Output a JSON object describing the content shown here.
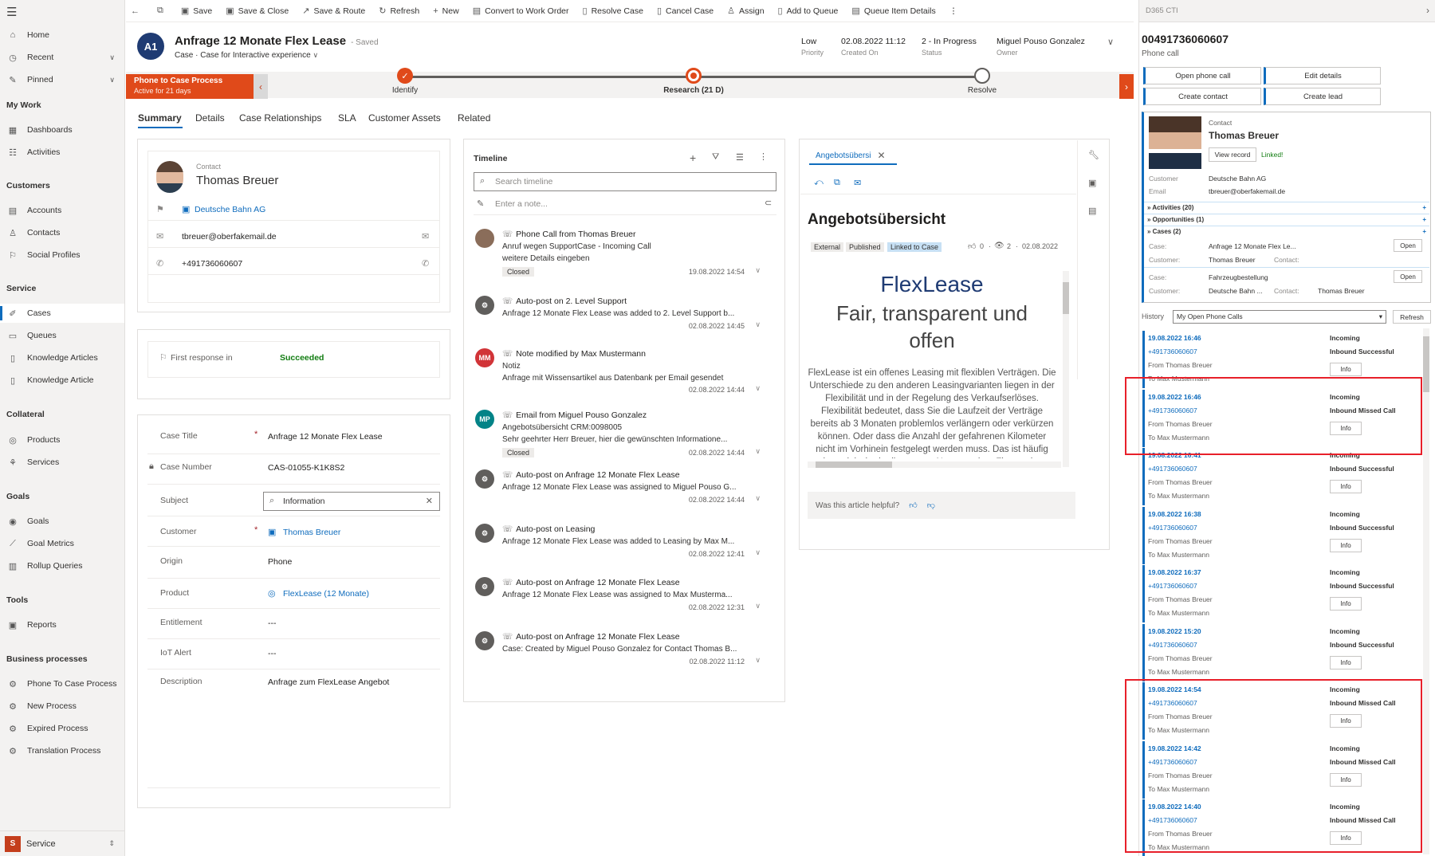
{
  "sidebar": {
    "top": [
      {
        "label": "Home",
        "icon": "home-icon"
      },
      {
        "label": "Recent",
        "icon": "clock-icon"
      },
      {
        "label": "Pinned",
        "icon": "pin-icon"
      }
    ],
    "sections": [
      {
        "title": "My Work",
        "items": [
          "Dashboards",
          "Activities"
        ]
      },
      {
        "title": "Customers",
        "items": [
          "Accounts",
          "Contacts",
          "Social Profiles"
        ]
      },
      {
        "title": "Service",
        "items": [
          "Cases",
          "Queues",
          "Knowledge Articles",
          "Knowledge Article"
        ]
      },
      {
        "title": "Collateral",
        "items": [
          "Products",
          "Services"
        ]
      },
      {
        "title": "Goals",
        "items": [
          "Goals",
          "Goal Metrics",
          "Rollup Queries"
        ]
      },
      {
        "title": "Tools",
        "items": [
          "Reports"
        ]
      },
      {
        "title": "Business processes",
        "items": [
          "Phone To Case Process",
          "New Process",
          "Expired Process",
          "Translation Process"
        ]
      }
    ],
    "area_badge": "S",
    "area_label": "Service"
  },
  "commands": [
    "Save",
    "Save & Close",
    "Save & Route",
    "Refresh",
    "New",
    "Convert to Work Order",
    "Resolve Case",
    "Cancel Case",
    "Assign",
    "Add to Queue",
    "Queue Item Details"
  ],
  "record": {
    "avatar": "A1",
    "title": "Anfrage 12 Monate Flex Lease",
    "saved": "- Saved",
    "entity": "Case",
    "form": "Case for Interactive experience",
    "priority_value": "Low",
    "priority_label": "Priority",
    "created_value": "02.08.2022 11:12",
    "created_label": "Created On",
    "status_value": "2 - In Progress",
    "status_label": "Status",
    "owner_value": "Miguel Pouso Gonzalez",
    "owner_label": "Owner"
  },
  "bpf": {
    "process": "Phone to Case Process",
    "active_for": "Active for 21 days",
    "stages": [
      "Identify",
      "Research  (21 D)",
      "Resolve"
    ]
  },
  "tabs": [
    "Summary",
    "Details",
    "Case Relationships",
    "SLA",
    "Customer Assets",
    "Related"
  ],
  "contact_card": {
    "label": "Contact",
    "name": "Thomas Breuer",
    "account": "Deutsche Bahn AG",
    "email": "tbreuer@oberfakemail.de",
    "phone": "+491736060607"
  },
  "sla": {
    "label": "First response in",
    "value": "Succeeded"
  },
  "case_fields": [
    {
      "label": "Case Title",
      "value": "Anfrage 12 Monate Flex Lease",
      "required": true
    },
    {
      "label": "Case Number",
      "value": "CAS-01055-K1K8S2",
      "locked": true
    },
    {
      "label": "Subject",
      "value": "Information"
    },
    {
      "label": "Customer",
      "value": "Thomas Breuer",
      "required": true
    },
    {
      "label": "Origin",
      "value": "Phone"
    },
    {
      "label": "Product",
      "value": "FlexLease (12 Monate)"
    },
    {
      "label": "Entitlement",
      "value": "---"
    },
    {
      "label": "IoT Alert",
      "value": "---"
    },
    {
      "label": "Description",
      "value": "Anfrage zum FlexLease Angebot"
    }
  ],
  "timeline": {
    "title": "Timeline",
    "search_placeholder": "Search timeline",
    "note_placeholder": "Enter a note...",
    "items": [
      {
        "avatar": "",
        "avatar_color": "#8a6d5a",
        "title": "Phone Call from Thomas Breuer",
        "line2": "Anruf wegen SupportCase - Incoming Call",
        "line3": "weitere Details eingeben",
        "badge": "Closed",
        "date": "19.08.2022 14:54"
      },
      {
        "avatar": "⚙",
        "avatar_color": "#605e5c",
        "title": "Auto-post on 2. Level Support",
        "line2": "Anfrage 12 Monate Flex Lease was added to 2. Level Support b...",
        "line3": "",
        "badge": "",
        "date": "02.08.2022 14:45"
      },
      {
        "avatar": "MM",
        "avatar_color": "#d13438",
        "title": "Note modified by Max Mustermann",
        "line2": "Notiz",
        "line3": "Anfrage mit Wissensartikel aus Datenbank per Email gesendet",
        "badge": "",
        "date": "02.08.2022 14:44"
      },
      {
        "avatar": "MP",
        "avatar_color": "#038387",
        "title": "Email from Miguel Pouso Gonzalez",
        "line2": "Angebotsübersicht CRM:0098005",
        "line3": "Sehr geehrter Herr Breuer,   hier die gewünschten Informatione...",
        "badge": "Closed",
        "date": "02.08.2022 14:44"
      },
      {
        "avatar": "⚙",
        "avatar_color": "#605e5c",
        "title": "Auto-post on Anfrage 12 Monate Flex Lease",
        "line2": "Anfrage 12 Monate Flex Lease was assigned to Miguel Pouso G...",
        "line3": "",
        "badge": "",
        "date": "02.08.2022 14:44"
      },
      {
        "avatar": "⚙",
        "avatar_color": "#605e5c",
        "title": "Auto-post on Leasing",
        "line2": "Anfrage 12 Monate Flex Lease was added to Leasing by Max M...",
        "line3": "",
        "badge": "",
        "date": "02.08.2022 12:41"
      },
      {
        "avatar": "⚙",
        "avatar_color": "#605e5c",
        "title": "Auto-post on Anfrage 12 Monate Flex Lease",
        "line2": "Anfrage 12 Monate Flex Lease was assigned to Max Musterma...",
        "line3": "",
        "badge": "",
        "date": "02.08.2022 12:31"
      },
      {
        "avatar": "⚙",
        "avatar_color": "#605e5c",
        "title": "Auto-post on Anfrage 12 Monate Flex Lease",
        "line2": "Case: Created by Miguel Pouso Gonzalez for Contact Thomas B...",
        "line3": "",
        "badge": "",
        "date": "02.08.2022 11:12"
      }
    ]
  },
  "kb": {
    "tab_label": "Angebotsübersi",
    "title": "Angebotsübersicht",
    "tags": [
      "External",
      "Published",
      "Linked to Case"
    ],
    "likes": "0",
    "views": "2",
    "date": "02.08.2022",
    "heading1": "FlexLease",
    "heading2": "Fair, transparent und offen",
    "body": "FlexLease ist ein offenes Leasing mit flexiblen Verträgen. Die Unterschiede zu den anderen Leasingvarianten liegen in der Flexibilität und in der Regelung des Verkaufserlöses. Flexibilität bedeutet, dass Sie die Laufzeit der Verträge bereits ab 3 Monaten problemlos verlängern oder verkürzen können. Oder dass die Anzahl der gefahrenen Kilometer nicht im Vorhinein festgelegt werden muss. Das ist häufig sehr praktisch, da die genaue Nutzung einer Flotte schwer",
    "helpful": "Was this article helpful?"
  },
  "cti": {
    "header": "D365 CTI",
    "number": "00491736060607",
    "call_type": "Phone call",
    "buttons": [
      "Open phone call",
      "Edit details",
      "Create contact",
      "Create lead"
    ],
    "contact_label": "Contact",
    "contact_name": "Thomas Breuer",
    "view_record": "View record",
    "linked": "Linked!",
    "customer_label": "Customer",
    "customer_value": "Deutsche Bahn AG",
    "email_label": "Email",
    "email_value": "tbreuer@oberfakemail.de",
    "sections": [
      "Activities (20)",
      "Opportunities (1)",
      "Cases (2)"
    ],
    "cases": [
      {
        "case_label": "Case:",
        "case_value": "Anfrage 12 Monate Flex Le...",
        "cust_label": "Customer:",
        "cust_value": "Thomas Breuer",
        "contact_label": "Contact:",
        "contact_value": "",
        "open": "Open"
      },
      {
        "case_label": "Case:",
        "case_value": "Fahrzeugbestellung",
        "cust_label": "Customer:",
        "cust_value": "Deutsche Bahn ...",
        "contact_label": "Contact:",
        "contact_value": "Thomas Breuer",
        "open": "Open"
      }
    ],
    "history_label": "History",
    "history_select": "My Open Phone Calls",
    "refresh": "Refresh",
    "history": [
      {
        "date": "19.08.2022 16:46",
        "number": "+491736060607",
        "from": "From Thomas Breuer",
        "to": "To Max Mustermann",
        "dir": "Incoming",
        "result": "Inbound Successful",
        "info": "Info"
      },
      {
        "date": "19.08.2022 16:46",
        "number": "+491736060607",
        "from": "From Thomas Breuer",
        "to": "To Max Mustermann",
        "dir": "Incoming",
        "result": "Inbound Missed Call",
        "info": "Info"
      },
      {
        "date": "19.08.2022 16:41",
        "number": "+491736060607",
        "from": "From Thomas Breuer",
        "to": "To Max Mustermann",
        "dir": "Incoming",
        "result": "Inbound Successful",
        "info": "Info"
      },
      {
        "date": "19.08.2022 16:38",
        "number": "+491736060607",
        "from": "From Thomas Breuer",
        "to": "To Max Mustermann",
        "dir": "Incoming",
        "result": "Inbound Successful",
        "info": "Info"
      },
      {
        "date": "19.08.2022 16:37",
        "number": "+491736060607",
        "from": "From Thomas Breuer",
        "to": "To Max Mustermann",
        "dir": "Incoming",
        "result": "Inbound Successful",
        "info": "Info"
      },
      {
        "date": "19.08.2022 15:20",
        "number": "+491736060607",
        "from": "From Thomas Breuer",
        "to": "To Max Mustermann",
        "dir": "Incoming",
        "result": "Inbound Successful",
        "info": "Info"
      },
      {
        "date": "19.08.2022 14:54",
        "number": "+491736060607",
        "from": "From Thomas Breuer",
        "to": "To Max Mustermann",
        "dir": "Incoming",
        "result": "Inbound Missed Call",
        "info": "Info"
      },
      {
        "date": "19.08.2022 14:42",
        "number": "+491736060607",
        "from": "From Thomas Breuer",
        "to": "To Max Mustermann",
        "dir": "Incoming",
        "result": "Inbound Missed Call",
        "info": "Info"
      },
      {
        "date": "19.08.2022 14:40",
        "number": "+491736060607",
        "from": "From Thomas Breuer",
        "to": "To Max Mustermann",
        "dir": "Incoming",
        "result": "Inbound Missed Call",
        "info": "Info"
      }
    ]
  },
  "colors": {
    "accent": "#0f6cbd",
    "bpf_active": "#e04a1a",
    "highlight": "#e8202a",
    "success": "#107c10"
  }
}
